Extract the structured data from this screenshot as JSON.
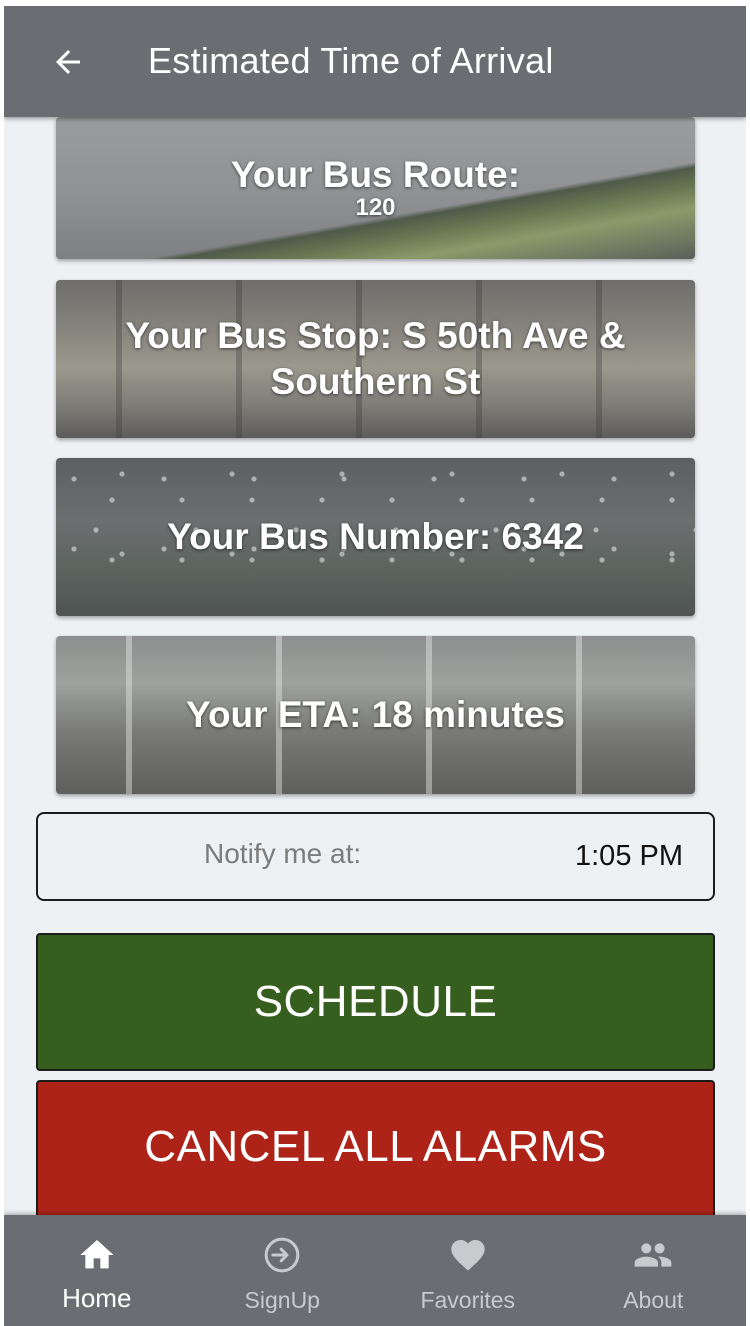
{
  "header": {
    "title": "Estimated Time of Arrival",
    "back_icon": "arrow-left-icon"
  },
  "cards": {
    "route_label": "Your Bus Route:",
    "route_value": "120",
    "stop_label": "Your Bus Stop: S 50th Ave & Southern St",
    "number_label": "Your Bus Number: 6342",
    "eta_label": "Your ETA: 18 minutes"
  },
  "notify": {
    "label": "Notify me at:",
    "time": "1:05 PM"
  },
  "buttons": {
    "schedule": "SCHEDULE",
    "cancel": "CANCEL ALL ALARMS"
  },
  "nav": {
    "items": [
      {
        "label": "Home",
        "icon": "home-icon",
        "active": true
      },
      {
        "label": "SignUp",
        "icon": "sign-in-icon",
        "active": false
      },
      {
        "label": "Favorites",
        "icon": "heart-icon",
        "active": false
      },
      {
        "label": "About",
        "icon": "people-icon",
        "active": false
      }
    ]
  },
  "colors": {
    "header_bg": "#6c6d72",
    "schedule_bg": "#365e1f",
    "cancel_bg": "#ad2318",
    "page_bg": "#eef1f4"
  }
}
